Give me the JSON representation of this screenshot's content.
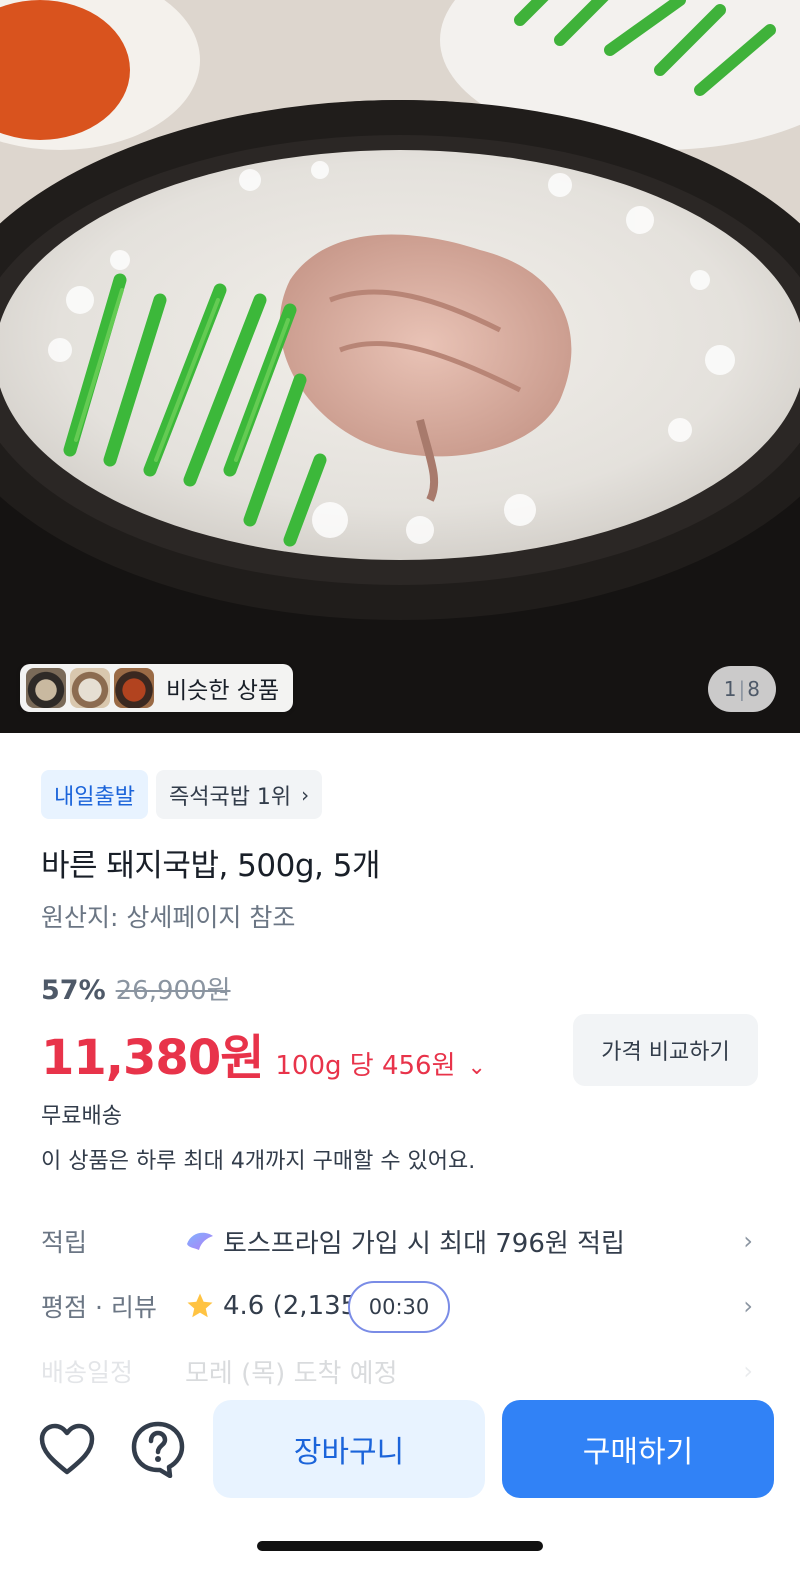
{
  "gallery": {
    "similar_label": "비슷한 상품",
    "page_current": "1",
    "page_total": "8"
  },
  "tags": [
    {
      "label": "내일출발"
    },
    {
      "label": "즉석국밥 1위"
    }
  ],
  "product": {
    "title": "바른 돼지국밥, 500g, 5개",
    "origin": "원산지: 상세페이지 참조",
    "discount": "57%",
    "original_price": "26,900원",
    "price": "11,380원",
    "unit_price": "100g 당 456원",
    "compare_label": "가격 비교하기",
    "shipping": "무료배송",
    "purchase_limit": "이 상품은 하루 최대 4개까지 구매할 수 있어요."
  },
  "info": {
    "points_label": "적립",
    "points_value": "토스프라임 가입 시 최대 796원 적립",
    "rating_label": "평점 · 리뷰",
    "rating_value": "4.6 (2,135",
    "timer": "00:30",
    "delivery_label": "배송일정",
    "delivery_value": "모레 (목) 도착 예정"
  },
  "actions": {
    "cart_label": "장바구니",
    "buy_label": "구매하기"
  },
  "colors": {
    "accent": "#3182f6",
    "price_red": "#e8334a",
    "tag_blue": "#1b64da"
  }
}
